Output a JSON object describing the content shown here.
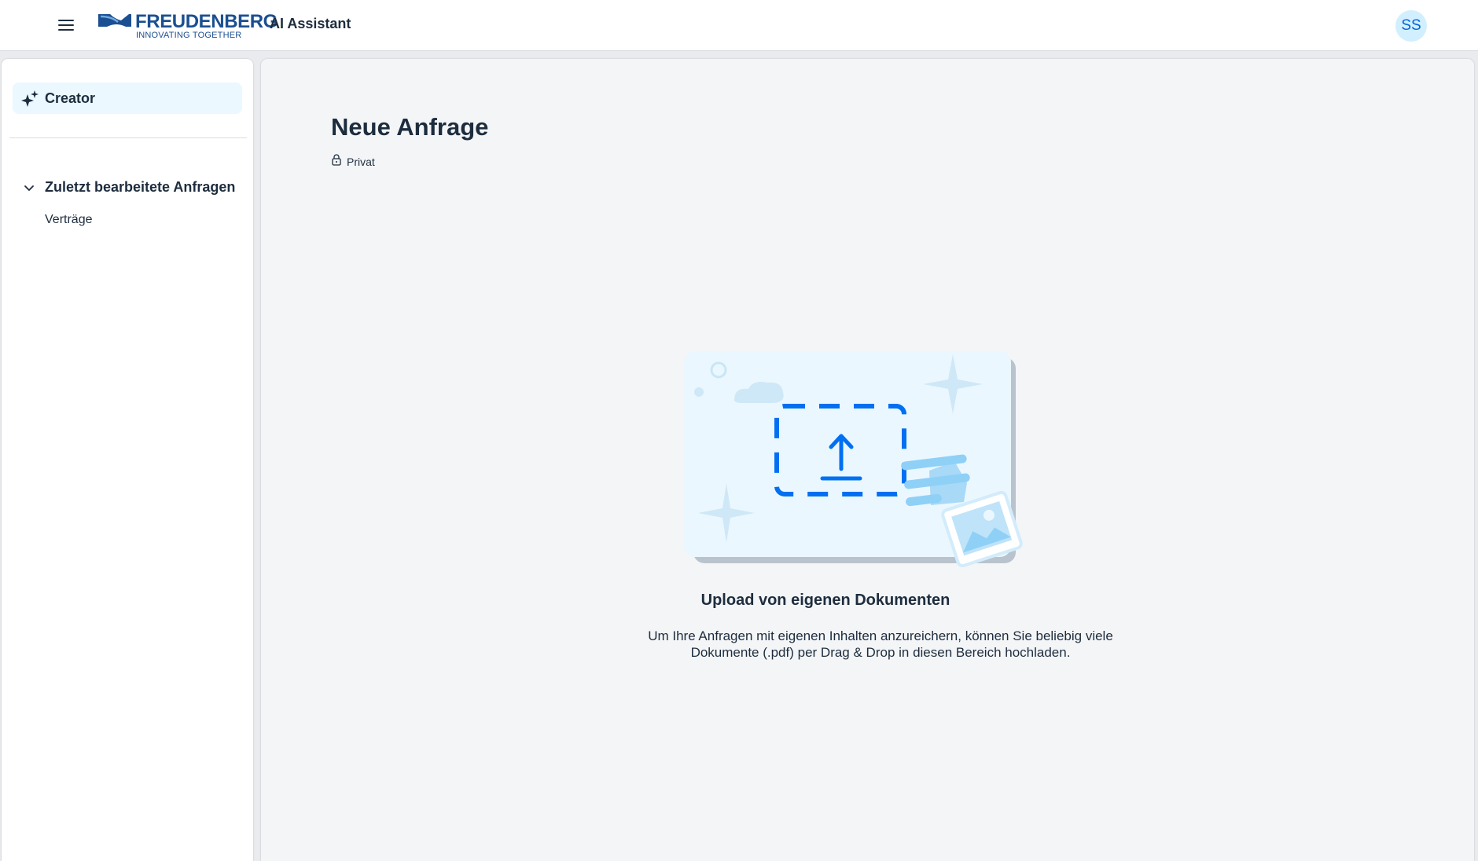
{
  "header": {
    "brand_name": "FREUDENBERG",
    "brand_tagline": "INNOVATING TOGETHER",
    "app_title": "AI Assistant",
    "user_initials": "SS",
    "menu_icon": "hamburger-menu-icon"
  },
  "sidebar": {
    "creator": {
      "label": "Creator",
      "icon": "ai-sparkle-icon"
    },
    "recent_group": {
      "label": "Zuletzt bearbeitete Anfragen",
      "expanded": true,
      "items": [
        {
          "label": "Verträge"
        }
      ]
    }
  },
  "main": {
    "title": "Neue Anfrage",
    "visibility": {
      "label": "Privat",
      "icon": "lock-icon"
    },
    "upload": {
      "title": "Upload von eigenen Dokumenten",
      "description": "Um Ihre Anfragen mit eigenen Inhalten anzureichern, können Sie beliebig viele Dokumente (.pdf) per Drag & Drop in diesen Bereich hochladen.",
      "illustration": "upload-illustration"
    }
  },
  "colors": {
    "brand_blue": "#1b4f91",
    "accent": "#0064d9",
    "selected_nav": "#ebf8ff",
    "avatar_bg": "#d1efff",
    "text": "#1d2d3e"
  }
}
